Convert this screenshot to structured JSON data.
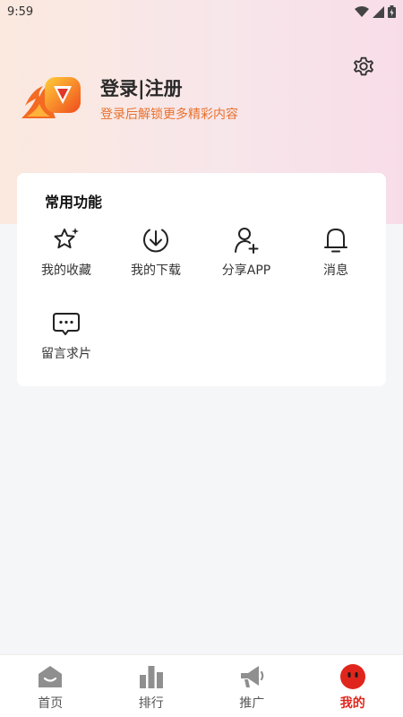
{
  "status_bar": {
    "time": "9:59"
  },
  "profile": {
    "title": "登录|注册",
    "subtitle": "登录后解锁更多精彩内容"
  },
  "features": {
    "title": "常用功能",
    "items": [
      {
        "label": "我的收藏",
        "icon": "star-icon"
      },
      {
        "label": "我的下载",
        "icon": "download-icon"
      },
      {
        "label": "分享APP",
        "icon": "share-user-icon"
      },
      {
        "label": "消息",
        "icon": "bell-icon"
      },
      {
        "label": "留言求片",
        "icon": "message-icon"
      }
    ]
  },
  "tabbar": {
    "items": [
      {
        "label": "首页",
        "icon": "home-icon"
      },
      {
        "label": "排行",
        "icon": "ranking-icon"
      },
      {
        "label": "推广",
        "icon": "megaphone-icon"
      },
      {
        "label": "我的",
        "icon": "face-icon",
        "active": true
      }
    ]
  },
  "colors": {
    "accent": "#e0261c",
    "subtitle": "#e8712e"
  }
}
